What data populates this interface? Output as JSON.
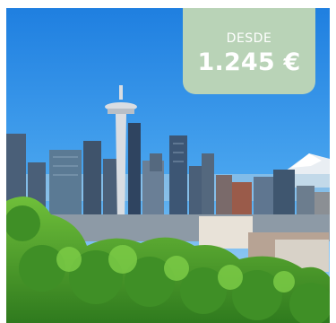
{
  "offer": {
    "price_label": "DESDE",
    "price_value": "1.245 €"
  },
  "image": {
    "subject": "seattle-skyline-photo"
  },
  "colors": {
    "badge": "#b9d3b7",
    "badge_text": "#ffffff",
    "sky": "#2d8fe6"
  }
}
